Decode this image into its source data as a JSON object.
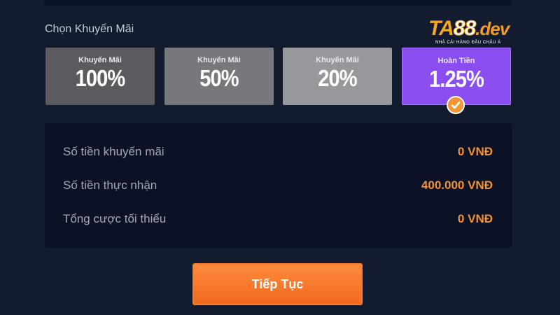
{
  "section_title": "Chọn Khuyến Mãi",
  "brand": {
    "name_ta": "TA",
    "name_num": "88",
    "name_dev": ".dev",
    "tagline": "NHÀ CÁI HÀNG ĐẦU CHÂU Á",
    "accent_color": "#f6a623"
  },
  "promotions": [
    {
      "caption": "Khuyến Mãi",
      "value": "100%",
      "selected": false,
      "color": "#5a5b5f"
    },
    {
      "caption": "Khuyến Mãi",
      "value": "50%",
      "selected": false,
      "color": "#77787c"
    },
    {
      "caption": "Khuyến Mãi",
      "value": "20%",
      "selected": false,
      "color": "#97989c"
    },
    {
      "caption": "Hoàn Tiền",
      "value": "1.25%",
      "selected": true,
      "color": "#8a4ef0"
    }
  ],
  "selected_icon": "check-icon",
  "summary": [
    {
      "label": "Số tiền khuyến mãi",
      "value": "0 VNĐ"
    },
    {
      "label": "Số tiền thực nhận",
      "value": "400.000 VNĐ"
    },
    {
      "label": "Tổng cược tối thiểu",
      "value": "0 VNĐ"
    }
  ],
  "continue_label": "Tiếp Tục",
  "colors": {
    "background": "#131b2f",
    "panel": "#0b1225",
    "value_orange": "#f29232",
    "button_orange": "#f06a1e"
  }
}
